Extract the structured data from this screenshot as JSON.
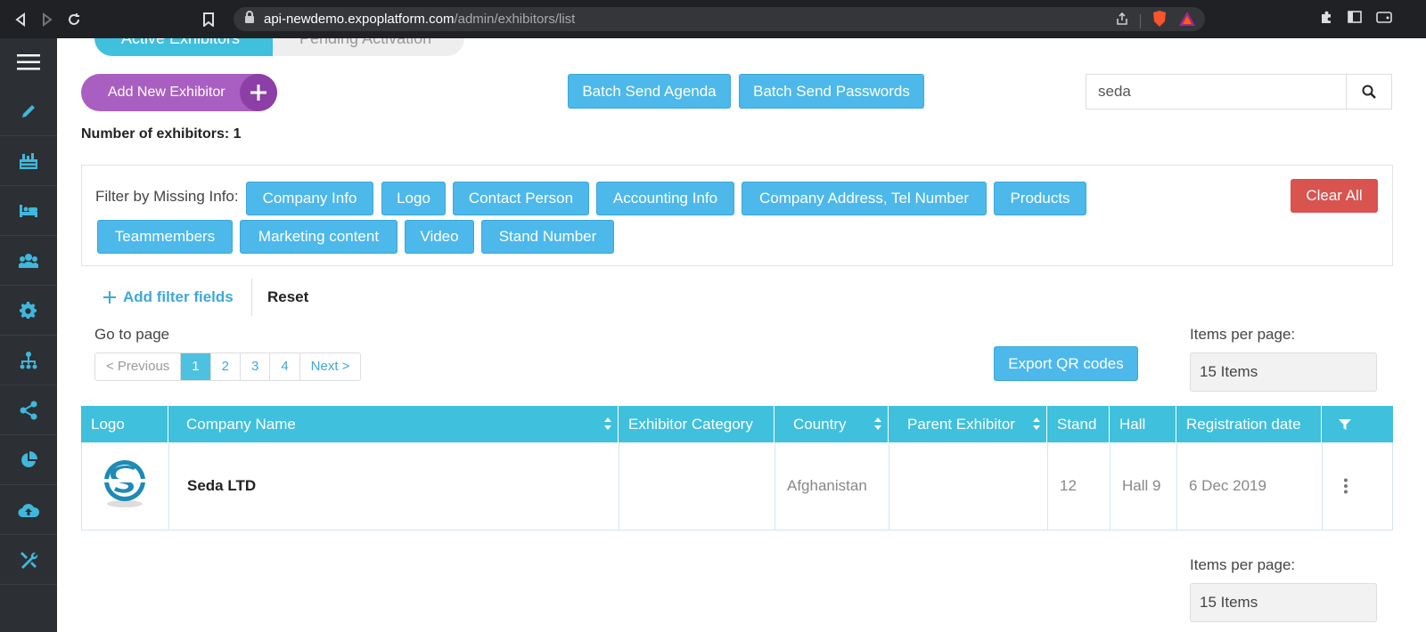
{
  "browser": {
    "url_host": "api-newdemo.expoplatform.com",
    "url_path": "/admin/exhibitors/list"
  },
  "sidebar": {
    "items": [
      {
        "icon": "pencil-icon"
      },
      {
        "icon": "exhibitor-desk-icon"
      },
      {
        "icon": "bed-icon"
      },
      {
        "icon": "users-icon"
      },
      {
        "icon": "gear-icon"
      },
      {
        "icon": "org-chart-icon"
      },
      {
        "icon": "share-icon"
      },
      {
        "icon": "pie-chart-icon"
      },
      {
        "icon": "cloud-upload-icon"
      },
      {
        "icon": "tools-icon"
      }
    ]
  },
  "tabs": {
    "active": "Active Exhibitors",
    "pending": "Pending Activation"
  },
  "toolbar": {
    "add_label": "Add New Exhibitor",
    "batch_agenda": "Batch Send Agenda",
    "batch_passwords": "Batch Send Passwords",
    "search_value": "seda"
  },
  "count_text": "Number of exhibitors: 1",
  "filters": {
    "label": "Filter by Missing Info:",
    "chips": [
      "Company Info",
      "Logo",
      "Contact Person",
      "Accounting Info",
      "Company Address, Tel Number",
      "Products",
      "Teammembers",
      "Marketing content",
      "Video",
      "Stand Number"
    ],
    "clear_all": "Clear All",
    "add_filter_fields": "Add filter fields",
    "reset": "Reset"
  },
  "pagination": {
    "goto_label": "Go to page",
    "prev": "< Previous",
    "pages": [
      "1",
      "2",
      "3",
      "4"
    ],
    "active_page": "1",
    "next": "Next >"
  },
  "export_qr": "Export QR codes",
  "items_per_page": {
    "label": "Items per page:",
    "value": "15 Items"
  },
  "table": {
    "columns": [
      "Logo",
      "Company Name",
      "Exhibitor Category",
      "Country",
      "Parent Exhibitor",
      "Stand",
      "Hall",
      "Registration date"
    ],
    "rows": [
      {
        "company": "Seda LTD",
        "category": "",
        "country": "Afghanistan",
        "parent": "",
        "stand": "12",
        "hall": "Hall 9",
        "registration": "6 Dec 2019"
      }
    ]
  },
  "colors": {
    "primary": "#4db8ea",
    "header": "#3fc0dc",
    "accent_purple": "#a95fc2",
    "danger": "#d9534f",
    "sidebar_bg": "#2c2f33"
  }
}
